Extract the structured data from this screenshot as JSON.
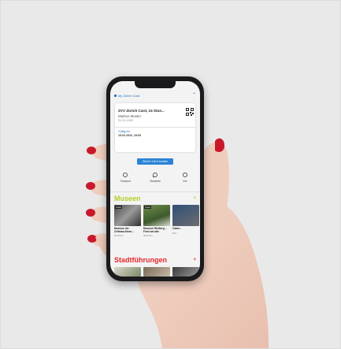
{
  "phone": {
    "header_title": "My Zürich Card",
    "card": {
      "name": "ZVV Zürich Card, 24 Stun...",
      "holder": "Markus Muster",
      "dob": "01.01.1990",
      "valid_label": "Gültig bis",
      "valid_date": "15.02.2022, 15:00"
    },
    "action_button": "Zürich Card kaufen",
    "quick_actions": [
      {
        "label": "Transport",
        "icon": "tram-icon"
      },
      {
        "label": "Standorte",
        "icon": "pin-icon"
      },
      {
        "label": "Info",
        "icon": "info-icon"
      }
    ],
    "museums": {
      "title": "Museen",
      "more": "+",
      "items": [
        {
          "tag": "Gratis",
          "caption": "Museum der Zeitmaschinen...",
          "distance": "⊕ 0,5 km"
        },
        {
          "tag": "Gratis",
          "caption": "Museum Rietberg – Forst am alte",
          "distance": "⊕ 0,9 km"
        },
        {
          "tag": "",
          "caption": "Cabar...",
          "distance": "⊕ 0..."
        }
      ]
    },
    "tours": {
      "title": "Stadtführungen",
      "more": "+"
    }
  },
  "colors": {
    "background": "#e9e9e9",
    "accent_blue": "#2a83d6",
    "museums_green": "#b1d024",
    "tours_red": "#e5272b",
    "nail_red": "#c9182b"
  }
}
